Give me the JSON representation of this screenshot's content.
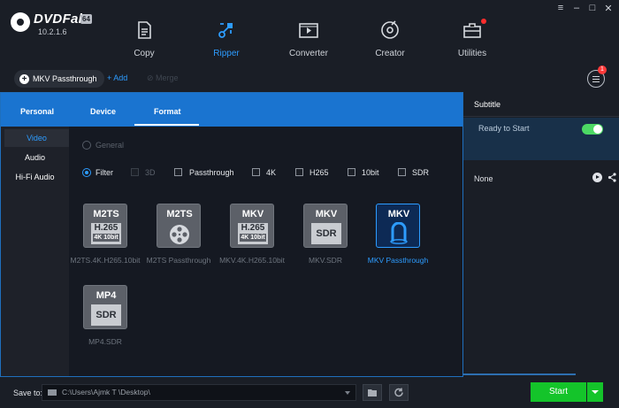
{
  "app": {
    "brand": "DVDFab",
    "brand_badge": "64",
    "version": "10.2.1.6"
  },
  "nav": [
    {
      "label": "Copy",
      "icon": "copy-icon"
    },
    {
      "label": "Ripper",
      "icon": "ripper-icon",
      "active": true
    },
    {
      "label": "Converter",
      "icon": "converter-icon"
    },
    {
      "label": "Creator",
      "icon": "creator-icon"
    },
    {
      "label": "Utilities",
      "icon": "utilities-icon",
      "has_badge": true
    }
  ],
  "toolbar": {
    "source_profile": "MKV Passthrough",
    "add_label": "Add",
    "merge_label": "Merge",
    "menu_badge": "1"
  },
  "right_panel": {
    "subtitle_header": "Subtitle",
    "ready_text": "Ready to Start",
    "subtitle_value": "None"
  },
  "profile_panel": {
    "tabs": [
      "Personal",
      "Device",
      "Format"
    ],
    "active_tab": "Format",
    "side_items": [
      "Video",
      "Audio",
      "Hi-Fi Audio"
    ],
    "selected_side_item": "Video",
    "mode_general": "General",
    "mode_filter": "Filter",
    "filters": [
      "3D",
      "Passthrough",
      "4K",
      "H265",
      "10bit",
      "SDR"
    ],
    "profiles": [
      {
        "caption": "M2TS.4K.H265.10bit",
        "top": "M2TS",
        "line1": "H.265",
        "line2": "4K 10bit"
      },
      {
        "caption": "M2TS Passthrough",
        "top": "M2TS"
      },
      {
        "caption": "MKV.4K.H265.10bit",
        "top": "MKV",
        "line1": "H.265",
        "line2": "4K 10bit"
      },
      {
        "caption": "MKV.SDR",
        "top": "MKV",
        "line1": "SDR"
      },
      {
        "caption": "MKV Passthrough",
        "top": "MKV",
        "selected": true
      },
      {
        "caption": "MP4.SDR",
        "top": "MP4",
        "line1": "SDR"
      }
    ]
  },
  "bottom": {
    "save_to_label": "Save to:",
    "save_path": "C:\\Users\\Ajmk T      \\Desktop\\",
    "start_label": "Start"
  },
  "colors": {
    "accent": "#2d9cff",
    "panel_blue": "#1a74d0",
    "start_green": "#14c42a"
  }
}
